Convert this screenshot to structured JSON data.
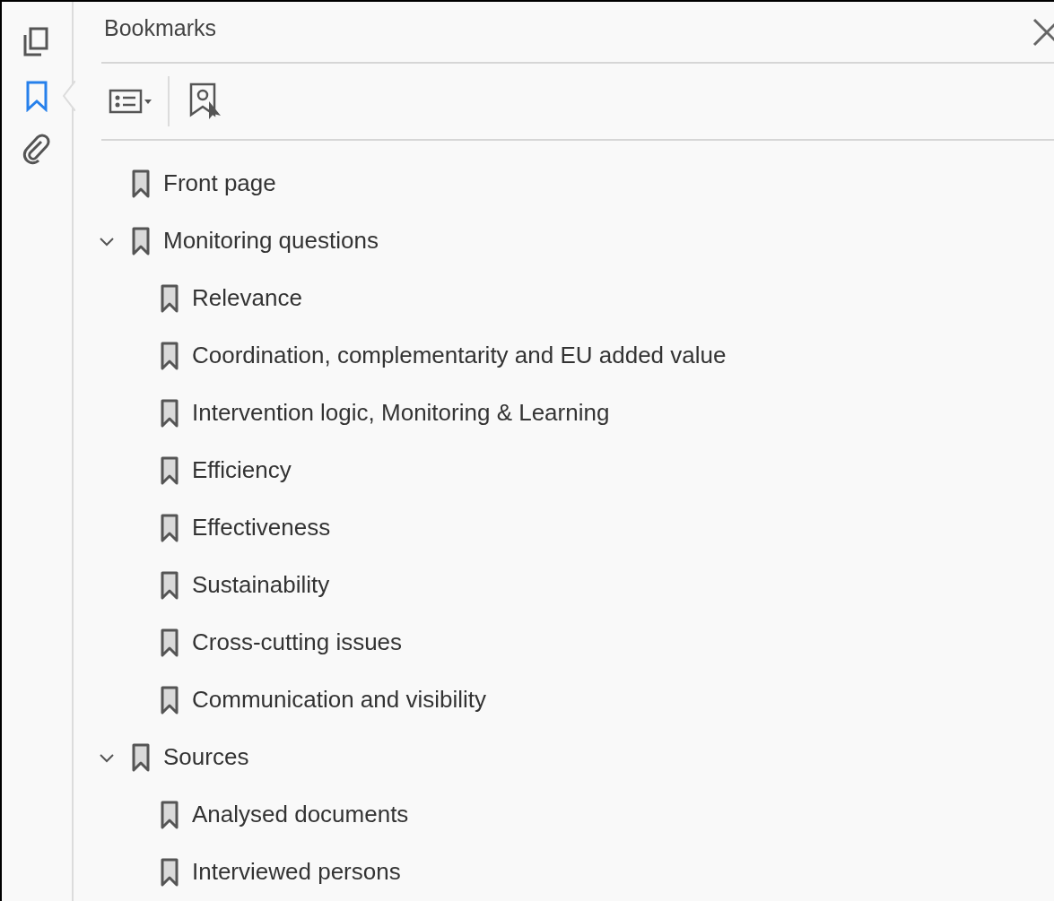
{
  "rail": [
    {
      "kind": "pages",
      "selected": false
    },
    {
      "kind": "bookmarks",
      "selected": true
    },
    {
      "kind": "attachments",
      "selected": false
    }
  ],
  "panel": {
    "title": "Bookmarks"
  },
  "bookmarks": [
    {
      "label": "Front page"
    },
    {
      "label": "Monitoring questions",
      "expanded": true,
      "children": [
        {
          "label": "Relevance"
        },
        {
          "label": "Coordination, complementarity and EU added value"
        },
        {
          "label": "Intervention logic, Monitoring & Learning"
        },
        {
          "label": "Efficiency"
        },
        {
          "label": "Effectiveness"
        },
        {
          "label": "Sustainability"
        },
        {
          "label": "Cross-cutting issues"
        },
        {
          "label": "Communication and visibility"
        }
      ]
    },
    {
      "label": "Sources",
      "expanded": true,
      "children": [
        {
          "label": "Analysed documents"
        },
        {
          "label": "Interviewed persons"
        }
      ]
    }
  ]
}
